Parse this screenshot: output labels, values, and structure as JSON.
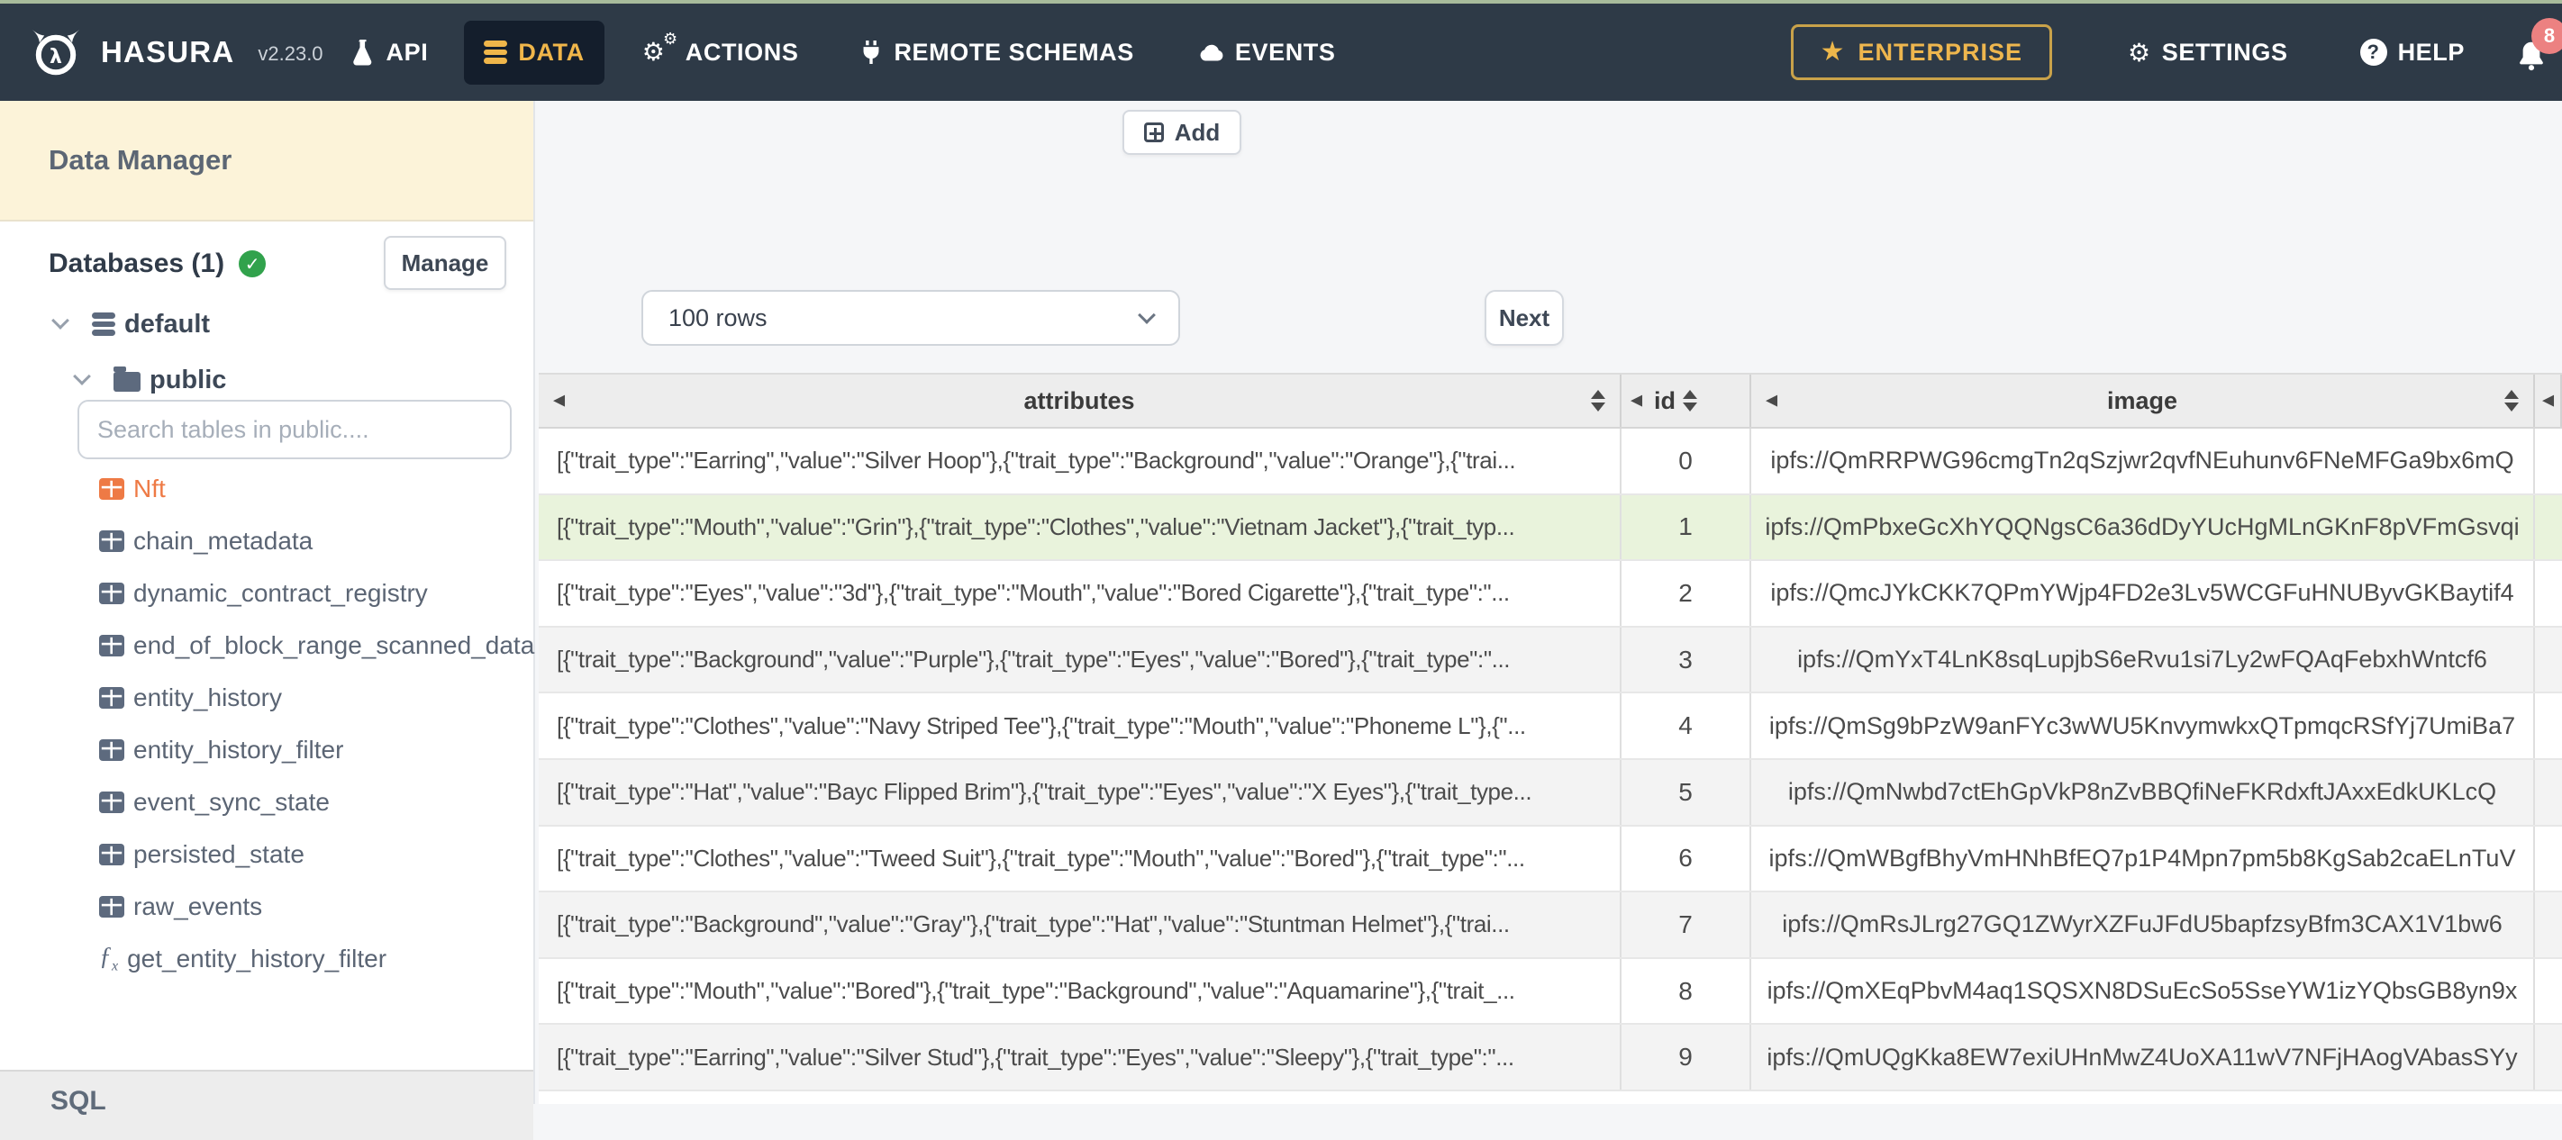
{
  "navbar": {
    "brand": "HASURA",
    "version": "v2.23.0",
    "items": [
      {
        "label": "API",
        "icon": "flask-icon",
        "active": false
      },
      {
        "label": "DATA",
        "icon": "database-icon",
        "active": true
      },
      {
        "label": "ACTIONS",
        "icon": "gears-icon",
        "active": false
      },
      {
        "label": "REMOTE SCHEMAS",
        "icon": "plug-icon",
        "active": false
      },
      {
        "label": "EVENTS",
        "icon": "cloud-icon",
        "active": false
      }
    ],
    "enterprise_label": "ENTERPRISE",
    "settings_label": "SETTINGS",
    "help_label": "HELP",
    "notification_count": "8",
    "accent_yellow": "#f0b64a",
    "bar_color": "#2e3a47"
  },
  "sidebar": {
    "title": "Data Manager",
    "databases_label": "Databases (1)",
    "manage_label": "Manage",
    "tree": {
      "database": "default",
      "schema": "public"
    },
    "search_placeholder": "Search tables in public....",
    "tables": [
      {
        "name": "Nft",
        "type": "table",
        "highlight": true
      },
      {
        "name": "chain_metadata",
        "type": "table",
        "highlight": false
      },
      {
        "name": "dynamic_contract_registry",
        "type": "table",
        "highlight": false
      },
      {
        "name": "end_of_block_range_scanned_data",
        "type": "table",
        "highlight": false
      },
      {
        "name": "entity_history",
        "type": "table",
        "highlight": false
      },
      {
        "name": "entity_history_filter",
        "type": "table",
        "highlight": false
      },
      {
        "name": "event_sync_state",
        "type": "table",
        "highlight": false
      },
      {
        "name": "persisted_state",
        "type": "table",
        "highlight": false
      },
      {
        "name": "raw_events",
        "type": "table",
        "highlight": false
      },
      {
        "name": "get_entity_history_filter",
        "type": "function",
        "highlight": false
      }
    ],
    "footer_label": "SQL",
    "highlight_color": "#ee7a45"
  },
  "toolbar": {
    "add_label": "Add",
    "rows_select_value": "100 rows",
    "next_label": "Next"
  },
  "table": {
    "columns": [
      "attributes",
      "id",
      "image"
    ],
    "highlighted_row_id": "1",
    "highlight_row_color": "#e9f3dc",
    "rows": [
      {
        "id": "0",
        "attributes": "[{\"trait_type\":\"Earring\",\"value\":\"Silver Hoop\"},{\"trait_type\":\"Background\",\"value\":\"Orange\"},{\"trai...",
        "image": "ipfs://QmRRPWG96cmgTn2qSzjwr2qvfNEuhunv6FNeMFGa9bx6mQ"
      },
      {
        "id": "1",
        "attributes": "[{\"trait_type\":\"Mouth\",\"value\":\"Grin\"},{\"trait_type\":\"Clothes\",\"value\":\"Vietnam Jacket\"},{\"trait_typ...",
        "image": "ipfs://QmPbxeGcXhYQQNgsC6a36dDyYUcHgMLnGKnF8pVFmGsvqi"
      },
      {
        "id": "2",
        "attributes": "[{\"trait_type\":\"Eyes\",\"value\":\"3d\"},{\"trait_type\":\"Mouth\",\"value\":\"Bored Cigarette\"},{\"trait_type\":\"...",
        "image": "ipfs://QmcJYkCKK7QPmYWjp4FD2e3Lv5WCGFuHNUByvGKBaytif4"
      },
      {
        "id": "3",
        "attributes": "[{\"trait_type\":\"Background\",\"value\":\"Purple\"},{\"trait_type\":\"Eyes\",\"value\":\"Bored\"},{\"trait_type\":\"...",
        "image": "ipfs://QmYxT4LnK8sqLupjbS6eRvu1si7Ly2wFQAqFebxhWntcf6"
      },
      {
        "id": "4",
        "attributes": "[{\"trait_type\":\"Clothes\",\"value\":\"Navy Striped Tee\"},{\"trait_type\":\"Mouth\",\"value\":\"Phoneme L\"},{\"...",
        "image": "ipfs://QmSg9bPzW9anFYc3wWU5KnvymwkxQTpmqcRSfYj7UmiBa7"
      },
      {
        "id": "5",
        "attributes": "[{\"trait_type\":\"Hat\",\"value\":\"Bayc Flipped Brim\"},{\"trait_type\":\"Eyes\",\"value\":\"X Eyes\"},{\"trait_type...",
        "image": "ipfs://QmNwbd7ctEhGpVkP8nZvBBQfiNeFKRdxftJAxxEdkUKLcQ"
      },
      {
        "id": "6",
        "attributes": "[{\"trait_type\":\"Clothes\",\"value\":\"Tweed Suit\"},{\"trait_type\":\"Mouth\",\"value\":\"Bored\"},{\"trait_type\":\"...",
        "image": "ipfs://QmWBgfBhyVmHNhBfEQ7p1P4Mpn7pm5b8KgSab2caELnTuV"
      },
      {
        "id": "7",
        "attributes": "[{\"trait_type\":\"Background\",\"value\":\"Gray\"},{\"trait_type\":\"Hat\",\"value\":\"Stuntman Helmet\"},{\"trai...",
        "image": "ipfs://QmRsJLrg27GQ1ZWyrXZFuJFdU5bapfzsyBfm3CAX1V1bw6"
      },
      {
        "id": "8",
        "attributes": "[{\"trait_type\":\"Mouth\",\"value\":\"Bored\"},{\"trait_type\":\"Background\",\"value\":\"Aquamarine\"},{\"trait_...",
        "image": "ipfs://QmXEqPbvM4aq1SQSXN8DSuEcSo5SseYW1izYQbsGB8yn9x"
      },
      {
        "id": "9",
        "attributes": "[{\"trait_type\":\"Earring\",\"value\":\"Silver Stud\"},{\"trait_type\":\"Eyes\",\"value\":\"Sleepy\"},{\"trait_type\":\"...",
        "image": "ipfs://QmUQgKka8EW7exiUHnMwZ4UoXA11wV7NFjHAogVAbasSYy"
      }
    ]
  }
}
